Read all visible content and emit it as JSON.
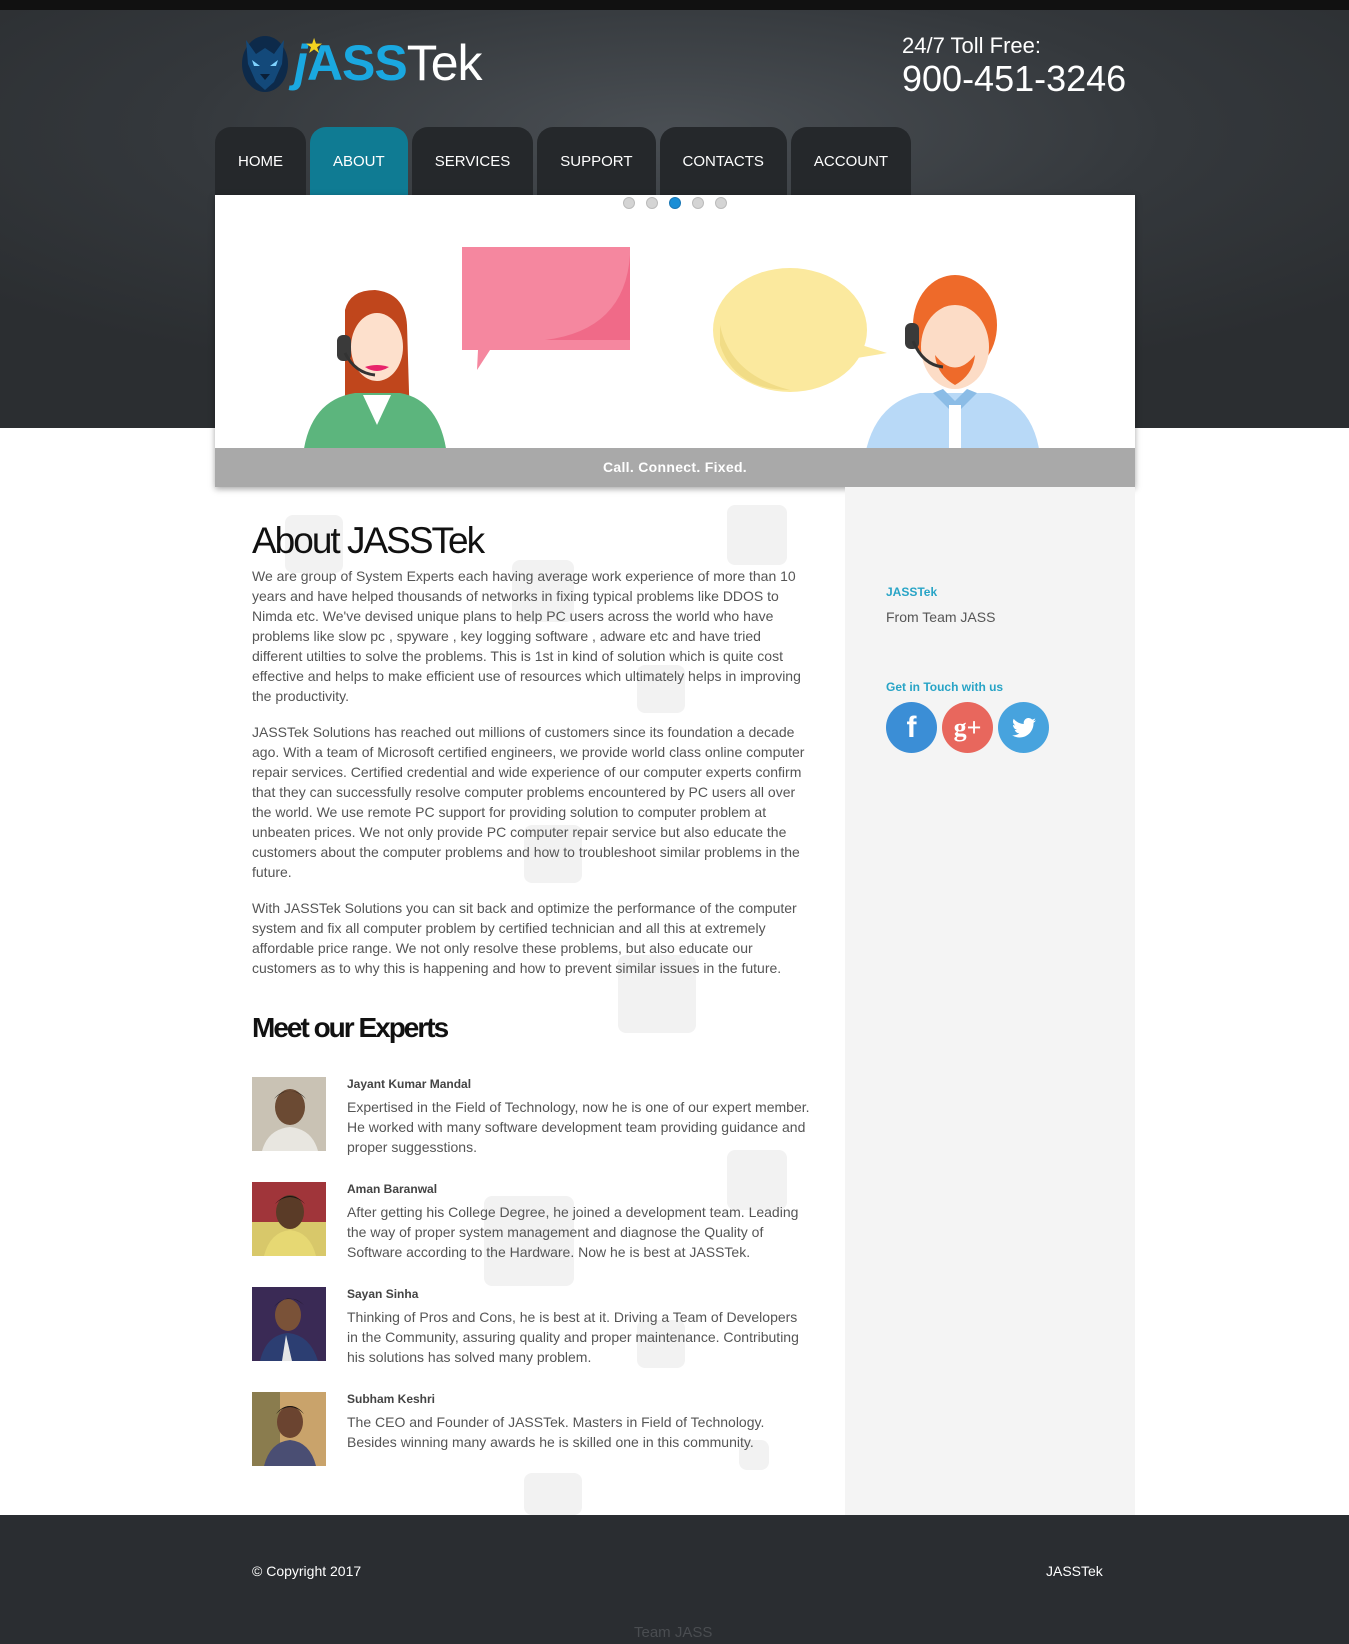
{
  "header": {
    "logo": {
      "j": "j",
      "ass": "ASS",
      "tek": "Tek"
    },
    "toll_free_label": "24/7 Toll Free:",
    "toll_free_number": "900-451-3246"
  },
  "nav": {
    "items": [
      {
        "label": "HOME"
      },
      {
        "label": "ABOUT",
        "active": true
      },
      {
        "label": "SERVICES"
      },
      {
        "label": "SUPPORT"
      },
      {
        "label": "CONTACTS"
      },
      {
        "label": "ACCOUNT"
      }
    ]
  },
  "slider": {
    "caption": "Call. Connect. Fixed.",
    "slide_count": 5,
    "active_slide": 3
  },
  "main": {
    "title": "About JASSTek",
    "paragraphs": [
      "We are group of System Experts each having average work experience of more than 10 years and have helped thousands of networks in fixing typical problems like DDOS to Nimda etc. We've devised unique plans to help PC users across the world who have problems like slow pc , spyware , key logging software , adware etc and have tried different utilties to solve the problems. This is 1st in kind of solution which is quite cost effective and helps to make efficient use of resources which ultimately helps in improving the productivity.",
      "JASSTek Solutions has reached out millions of customers since its foundation a decade ago. With a team of Microsoft certified engineers, we provide world class online computer repair services. Certified credential and wide experience of our computer experts confirm that they can successfully resolve computer problems encountered by PC users all over the world. We use remote PC support for providing solution to computer problem at unbeaten prices. We not only provide PC computer repair service but also educate the customers about the computer problems and how to troubleshoot similar problems in the future.",
      "With JASSTek Solutions you can sit back and optimize the performance of the computer system and fix all computer problem by certified technician and all this at extremely affordable price range. We not only resolve these problems, but also educate our customers as to why this is happening and how to prevent similar issues in the future."
    ],
    "experts_title": "Meet our Experts",
    "experts": [
      {
        "name": "Jayant Kumar Mandal",
        "bio": "Expertised in the Field of Technology, now he is one of our expert member. He worked with many software development team providing guidance and proper suggesstions."
      },
      {
        "name": "Aman Baranwal",
        "bio": "After getting his College Degree, he joined a development team. Leading the way of proper system management and diagnose the Quality of Software according to the Hardware. Now he is best at JASSTek."
      },
      {
        "name": "Sayan Sinha",
        "bio": "Thinking of Pros and Cons, he is best at it. Driving a Team of Developers in the Community, assuring quality and proper maintenance. Contributing his solutions has solved many problem."
      },
      {
        "name": "Subham Keshri",
        "bio": "The CEO and Founder of JASSTek. Masters in Field of Technology. Besides winning many awards he is skilled one in this community."
      }
    ]
  },
  "sidebar": {
    "brand": "JASSTek",
    "team": "From Team JASS",
    "touch_title": "Get in Touch with us",
    "social": [
      {
        "icon": "facebook-icon",
        "glyph": "f",
        "color": "#3b8ed6"
      },
      {
        "icon": "google-plus-icon",
        "glyph": "g+",
        "color": "#e8675d"
      },
      {
        "icon": "twitter-icon",
        "glyph": "",
        "color": "#47a3de"
      }
    ]
  },
  "footer": {
    "copyright": "© Copyright 2017",
    "brand": "JASSTek",
    "team": "Team JASS"
  },
  "colors": {
    "accent": "#0f7b93",
    "link": "#28a4c6",
    "header_bg": "#34383c",
    "footer_bg": "#2a2d31"
  }
}
